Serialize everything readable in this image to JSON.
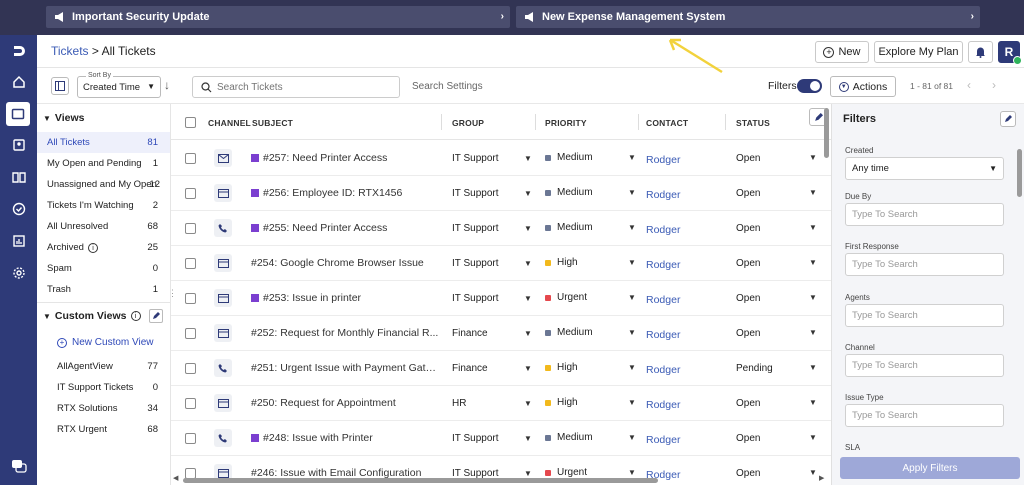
{
  "announcements": [
    {
      "label": "Important Security Update",
      "icon": "megaphone-icon"
    },
    {
      "label": "New Expense Management System",
      "icon": "megaphone-icon"
    }
  ],
  "breadcrumb": {
    "root": "Tickets",
    "separator": " > ",
    "current": "All Tickets"
  },
  "header": {
    "new_label": "New",
    "explore_label": "Explore My Plan",
    "avatar_initial": "R"
  },
  "toolbar": {
    "sort_by_label": "Sort By",
    "sort_value": "Created Time",
    "search_placeholder": "Search Tickets",
    "search_settings": "Search Settings",
    "filters_label": "Filters",
    "actions_label": "Actions",
    "pagination": "1 - 81 of 81"
  },
  "sidebar": {
    "views_title": "Views",
    "views": [
      {
        "label": "All Tickets",
        "count": "81"
      },
      {
        "label": "My Open and Pending",
        "count": "1"
      },
      {
        "label": "Unassigned and My Open",
        "count": "12"
      },
      {
        "label": "Tickets I'm Watching",
        "count": "2"
      },
      {
        "label": "All Unresolved",
        "count": "68"
      },
      {
        "label": "Archived",
        "count": "25"
      },
      {
        "label": "Spam",
        "count": "0"
      },
      {
        "label": "Trash",
        "count": "1"
      }
    ],
    "custom_title": "Custom Views",
    "new_custom": "New Custom View",
    "custom_views": [
      {
        "label": "AllAgentView",
        "count": "77"
      },
      {
        "label": "IT Support Tickets",
        "count": "0"
      },
      {
        "label": "RTX Solutions",
        "count": "34"
      },
      {
        "label": "RTX Urgent",
        "count": "68"
      }
    ]
  },
  "table": {
    "columns": [
      "CHANNEL",
      "SUBJECT",
      "GROUP",
      "PRIORITY",
      "CONTACT",
      "STATUS"
    ],
    "rows": [
      {
        "channel": "email",
        "subject": "#257: Need Printer Access",
        "tag": true,
        "group": "IT Support",
        "priority": "Medium",
        "contact": "Rodger",
        "status": "Open"
      },
      {
        "channel": "portal",
        "subject": "#256: Employee ID: RTX1456",
        "tag": true,
        "group": "IT Support",
        "priority": "Medium",
        "contact": "Rodger",
        "status": "Open"
      },
      {
        "channel": "phone",
        "subject": "#255: Need Printer Access",
        "tag": true,
        "group": "IT Support",
        "priority": "Medium",
        "contact": "Rodger",
        "status": "Open"
      },
      {
        "channel": "portal",
        "subject": "#254: Google Chrome Browser Issue",
        "tag": false,
        "group": "IT Support",
        "priority": "High",
        "contact": "Rodger",
        "status": "Open"
      },
      {
        "channel": "portal",
        "subject": "#253: Issue in printer",
        "tag": true,
        "group": "IT Support",
        "priority": "Urgent",
        "contact": "Rodger",
        "status": "Open"
      },
      {
        "channel": "portal",
        "subject": "#252: Request for Monthly Financial R...",
        "tag": false,
        "group": "Finance",
        "priority": "Medium",
        "contact": "Rodger",
        "status": "Open"
      },
      {
        "channel": "phone",
        "subject": "#251: Urgent Issue with Payment Gatew...",
        "tag": false,
        "group": "Finance",
        "priority": "High",
        "contact": "Rodger",
        "status": "Pending"
      },
      {
        "channel": "portal",
        "subject": "#250: Request for Appointment",
        "tag": false,
        "group": "HR",
        "priority": "High",
        "contact": "Rodger",
        "status": "Open"
      },
      {
        "channel": "phone",
        "subject": "#248: Issue with Printer",
        "tag": true,
        "group": "IT Support",
        "priority": "Medium",
        "contact": "Rodger",
        "status": "Open"
      },
      {
        "channel": "portal",
        "subject": "#246: Issue with Email Configuration",
        "tag": false,
        "group": "IT Support",
        "priority": "Urgent",
        "contact": "Rodger",
        "status": "Open"
      }
    ]
  },
  "filters": {
    "title": "Filters",
    "fields": [
      {
        "label": "Created",
        "value": "Any time",
        "type": "select"
      },
      {
        "label": "Due By",
        "value": "Type To Search",
        "type": "search"
      },
      {
        "label": "First Response",
        "value": "Type To Search",
        "type": "search"
      },
      {
        "label": "Agents",
        "value": "Type To Search",
        "type": "search"
      },
      {
        "label": "Channel",
        "value": "Type To Search",
        "type": "search"
      },
      {
        "label": "Issue Type",
        "value": "Type To Search",
        "type": "search"
      },
      {
        "label": "SLA",
        "value": "",
        "type": "label"
      }
    ],
    "apply_label": "Apply Filters"
  },
  "colors": {
    "medium": "#6b7794",
    "high": "#f2b91c",
    "urgent": "#e5484d",
    "accent": "#2f49b8",
    "nav_bg": "#2e3a78",
    "topbar_bg": "#323454"
  }
}
